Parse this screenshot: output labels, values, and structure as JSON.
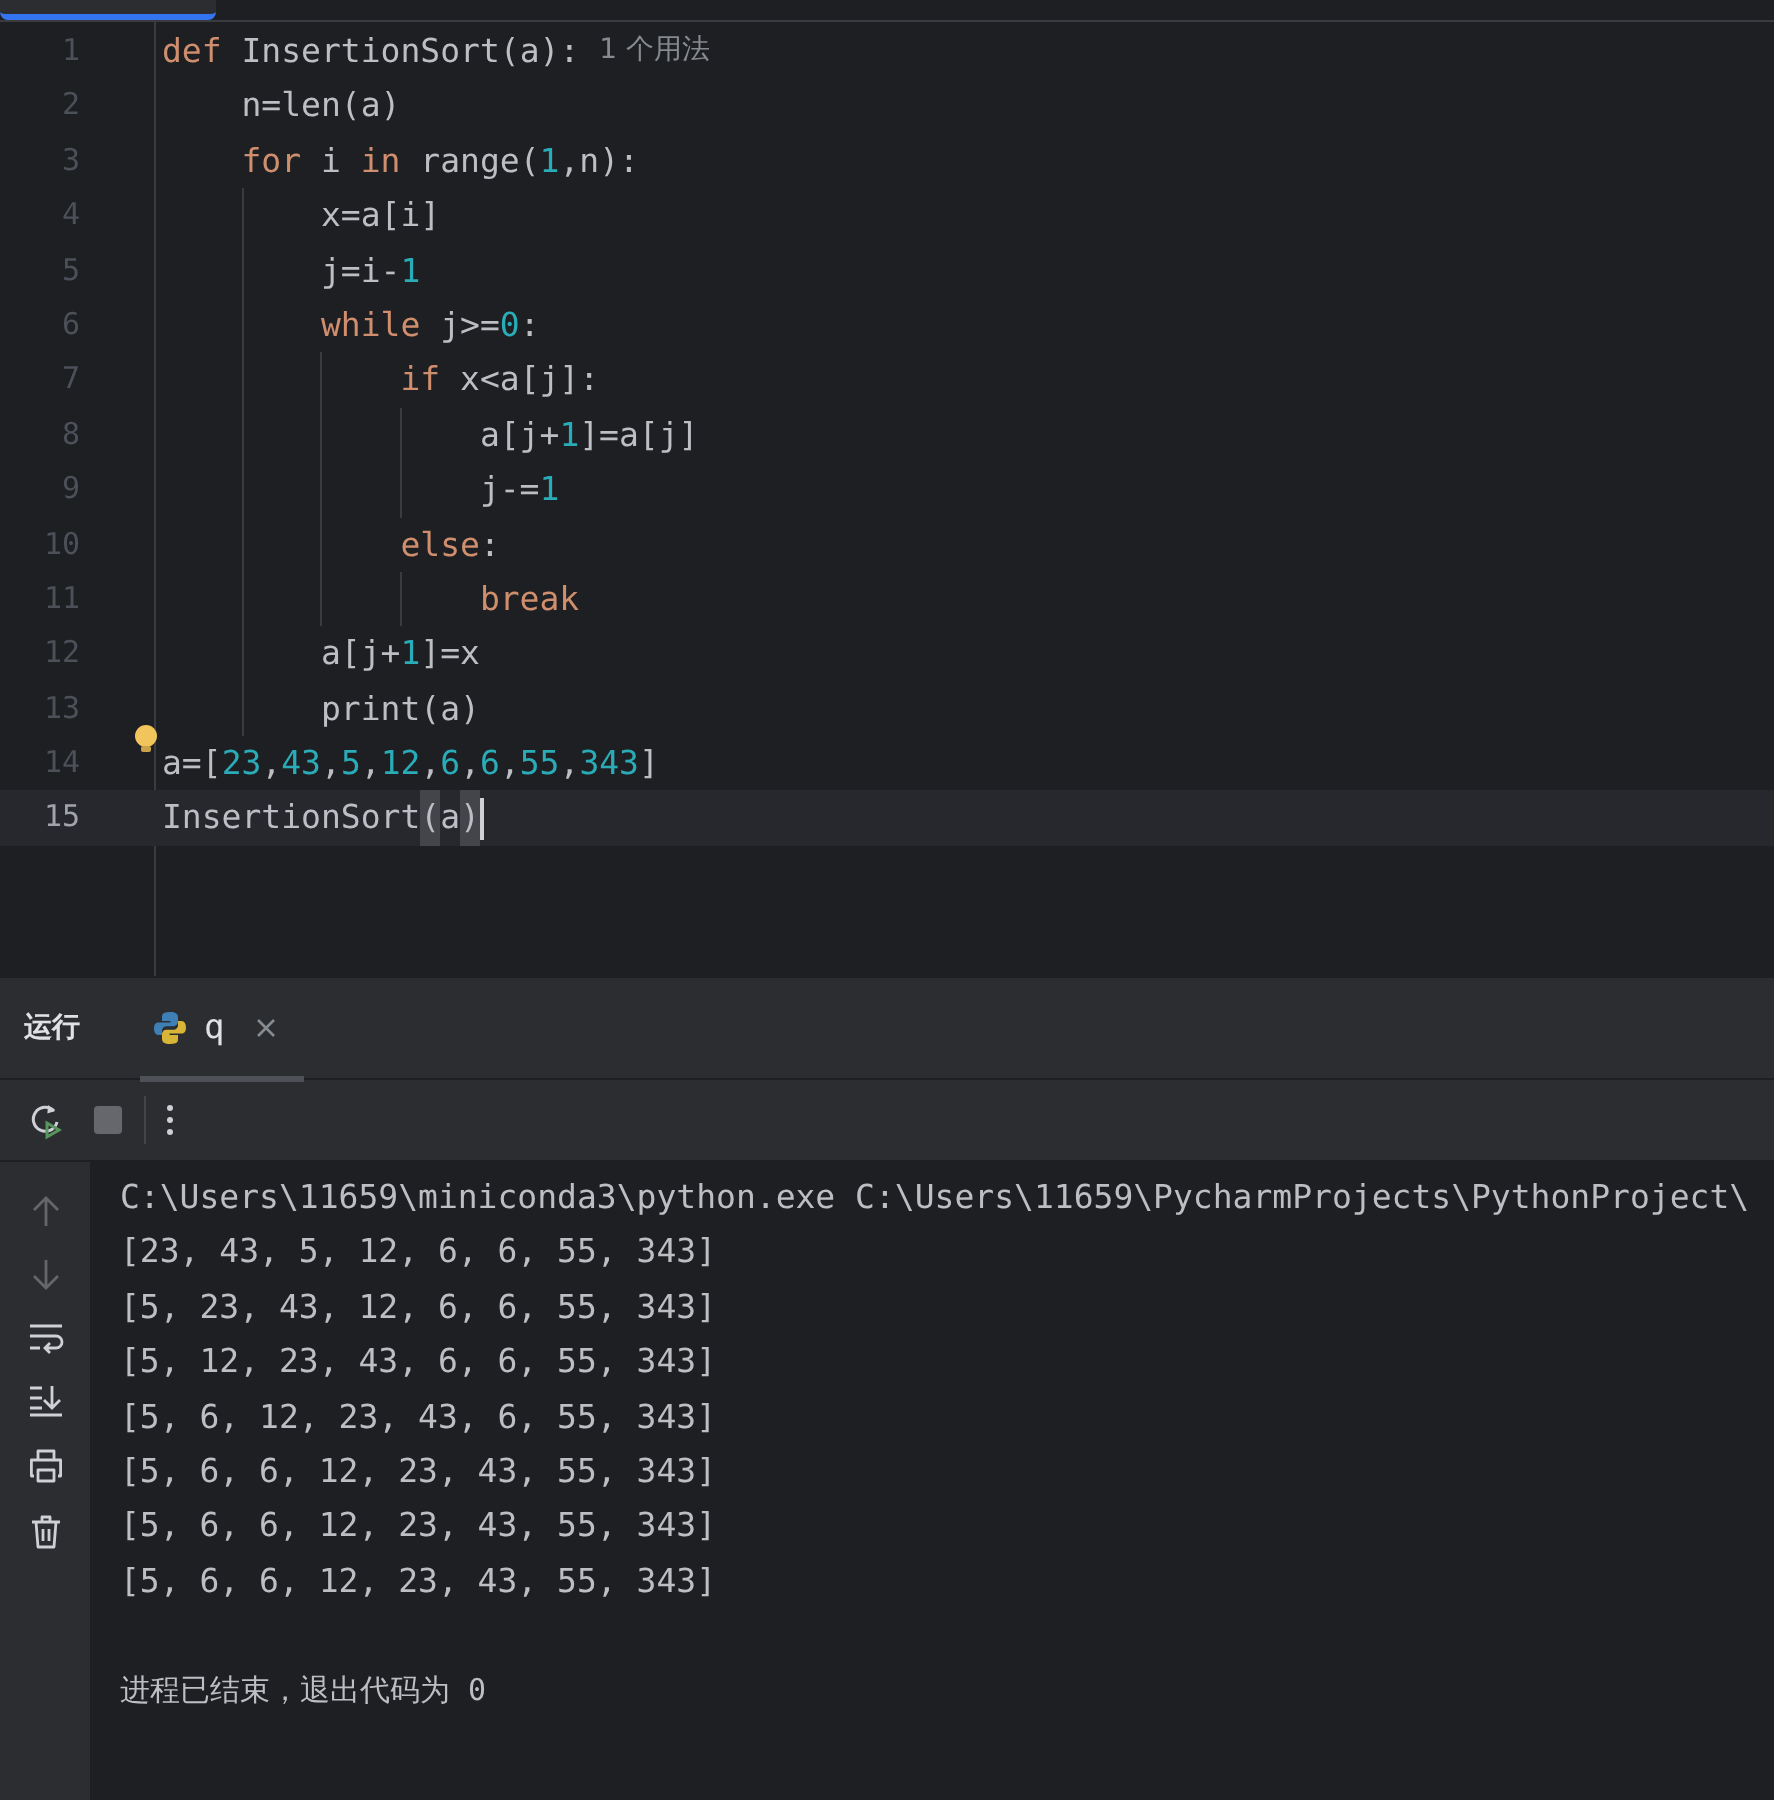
{
  "editor": {
    "lines": [
      {
        "number": "1",
        "current": false,
        "tokens": [
          {
            "kind": "keyword",
            "text": "def "
          },
          {
            "kind": "plain",
            "text": "InsertionSort(a):"
          },
          {
            "kind": "hint",
            "text": "1 个用法"
          }
        ],
        "children": [
          {
            "number": "2",
            "current": false,
            "tokens": [
              {
                "kind": "plain",
                "text": "n=len(a)"
              }
            ]
          },
          {
            "number": "3",
            "current": false,
            "tokens": [
              {
                "kind": "keyword",
                "text": "for "
              },
              {
                "kind": "plain",
                "text": "i "
              },
              {
                "kind": "keyword",
                "text": "in "
              },
              {
                "kind": "plain",
                "text": "range("
              },
              {
                "kind": "number",
                "text": "1"
              },
              {
                "kind": "plain",
                "text": ",n):"
              }
            ],
            "children": [
              {
                "number": "4",
                "current": false,
                "tokens": [
                  {
                    "kind": "plain",
                    "text": "x=a[i]"
                  }
                ]
              },
              {
                "number": "5",
                "current": false,
                "tokens": [
                  {
                    "kind": "plain",
                    "text": "j=i-"
                  },
                  {
                    "kind": "number",
                    "text": "1"
                  }
                ]
              },
              {
                "number": "6",
                "current": false,
                "tokens": [
                  {
                    "kind": "keyword",
                    "text": "while "
                  },
                  {
                    "kind": "plain",
                    "text": "j>="
                  },
                  {
                    "kind": "number",
                    "text": "0"
                  },
                  {
                    "kind": "plain",
                    "text": ":"
                  }
                ],
                "children": [
                  {
                    "number": "7",
                    "current": false,
                    "tokens": [
                      {
                        "kind": "keyword",
                        "text": "if "
                      },
                      {
                        "kind": "plain",
                        "text": "x<a[j]:"
                      }
                    ],
                    "children": [
                      {
                        "number": "8",
                        "current": false,
                        "tokens": [
                          {
                            "kind": "plain",
                            "text": "a[j+"
                          },
                          {
                            "kind": "number",
                            "text": "1"
                          },
                          {
                            "kind": "plain",
                            "text": "]=a[j]"
                          }
                        ]
                      },
                      {
                        "number": "9",
                        "current": false,
                        "tokens": [
                          {
                            "kind": "plain",
                            "text": "j-="
                          },
                          {
                            "kind": "number",
                            "text": "1"
                          }
                        ]
                      }
                    ]
                  },
                  {
                    "number": "10",
                    "current": false,
                    "tokens": [
                      {
                        "kind": "keyword",
                        "text": "else"
                      },
                      {
                        "kind": "plain",
                        "text": ":"
                      }
                    ],
                    "children": [
                      {
                        "number": "11",
                        "current": false,
                        "tokens": [
                          {
                            "kind": "keyword",
                            "text": "break"
                          }
                        ]
                      }
                    ]
                  }
                ]
              },
              {
                "number": "12",
                "current": false,
                "tokens": [
                  {
                    "kind": "plain",
                    "text": "a[j+"
                  },
                  {
                    "kind": "number",
                    "text": "1"
                  },
                  {
                    "kind": "plain",
                    "text": "]=x"
                  }
                ]
              },
              {
                "number": "13",
                "current": false,
                "tokens": [
                  {
                    "kind": "plain",
                    "text": "print(a)"
                  }
                ]
              }
            ]
          }
        ]
      },
      {
        "number": "14",
        "current": false,
        "bulb": true,
        "tokens": [
          {
            "kind": "plain",
            "text": "a=["
          },
          {
            "kind": "number",
            "text": "23"
          },
          {
            "kind": "plain",
            "text": ","
          },
          {
            "kind": "number",
            "text": "43"
          },
          {
            "kind": "plain",
            "text": ","
          },
          {
            "kind": "number",
            "text": "5"
          },
          {
            "kind": "plain",
            "text": ","
          },
          {
            "kind": "number",
            "text": "12"
          },
          {
            "kind": "plain",
            "text": ","
          },
          {
            "kind": "number",
            "text": "6"
          },
          {
            "kind": "plain",
            "text": ","
          },
          {
            "kind": "number",
            "text": "6"
          },
          {
            "kind": "plain",
            "text": ","
          },
          {
            "kind": "number",
            "text": "55"
          },
          {
            "kind": "plain",
            "text": ","
          },
          {
            "kind": "number",
            "text": "343"
          },
          {
            "kind": "plain",
            "text": "]"
          }
        ]
      },
      {
        "number": "15",
        "current": true,
        "tokens": [
          {
            "kind": "plain",
            "text": "InsertionSort"
          },
          {
            "kind": "match",
            "text": "("
          },
          {
            "kind": "plain",
            "text": "a"
          },
          {
            "kind": "match",
            "text": ")"
          }
        ]
      }
    ]
  },
  "run_panel": {
    "title": "运行",
    "tabs": [
      {
        "label": "q",
        "selected": true
      }
    ],
    "toolbar": [
      {
        "kind": "rerun",
        "disabled": false
      },
      {
        "kind": "stop",
        "disabled": true
      },
      {
        "kind": "divider"
      },
      {
        "kind": "more",
        "disabled": false
      }
    ],
    "side_tools": [
      {
        "kind": "up",
        "disabled": true
      },
      {
        "kind": "down",
        "disabled": true
      },
      {
        "kind": "wrap",
        "disabled": false
      },
      {
        "kind": "scroll-end",
        "disabled": false
      },
      {
        "kind": "print",
        "disabled": false
      },
      {
        "kind": "trash",
        "disabled": false
      }
    ],
    "console": [
      {
        "kind": "command",
        "text": "C:\\Users\\11659\\miniconda3\\python.exe C:\\Users\\11659\\PycharmProjects\\PythonProject\\"
      },
      {
        "kind": "output",
        "text": "[23, 43, 5, 12, 6, 6, 55, 343]"
      },
      {
        "kind": "output",
        "text": "[5, 23, 43, 12, 6, 6, 55, 343]"
      },
      {
        "kind": "output",
        "text": "[5, 12, 23, 43, 6, 6, 55, 343]"
      },
      {
        "kind": "output",
        "text": "[5, 6, 12, 23, 43, 6, 55, 343]"
      },
      {
        "kind": "output",
        "text": "[5, 6, 6, 12, 23, 43, 55, 343]"
      },
      {
        "kind": "output",
        "text": "[5, 6, 6, 12, 23, 43, 55, 343]"
      },
      {
        "kind": "output",
        "text": "[5, 6, 6, 12, 23, 43, 55, 343]"
      },
      {
        "kind": "exit",
        "text": "进程已结束，退出代码为 0"
      }
    ]
  }
}
